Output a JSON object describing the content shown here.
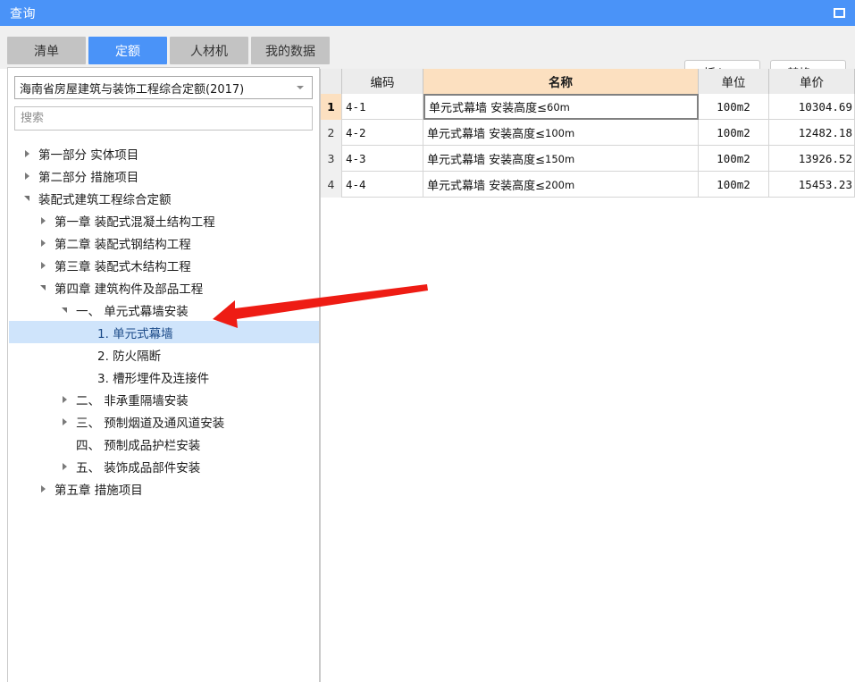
{
  "window": {
    "title": "查询",
    "restore_icon": "restore-window-icon"
  },
  "tabs": [
    {
      "label": "清单",
      "active": false
    },
    {
      "label": "定额",
      "active": true
    },
    {
      "label": "人材机",
      "active": false
    },
    {
      "label": "我的数据",
      "active": false
    }
  ],
  "toolbar": {
    "insert_label": "插入(I)",
    "replace_label": "替换(R)"
  },
  "left_panel": {
    "library_select": {
      "value": "海南省房屋建筑与装饰工程综合定额(2017)",
      "arrow_icon": "chevron-down-icon"
    },
    "search": {
      "value": "",
      "placeholder": "搜索"
    },
    "tree": [
      {
        "label": "第一部分 实体项目",
        "depth": 0,
        "state": "collapsed",
        "selected": false
      },
      {
        "label": "第二部分 措施项目",
        "depth": 0,
        "state": "collapsed",
        "selected": false
      },
      {
        "label": "装配式建筑工程综合定额",
        "depth": 0,
        "state": "expanded",
        "selected": false
      },
      {
        "label": "第一章 装配式混凝土结构工程",
        "depth": 1,
        "state": "collapsed",
        "selected": false
      },
      {
        "label": "第二章 装配式钢结构工程",
        "depth": 1,
        "state": "collapsed",
        "selected": false
      },
      {
        "label": "第三章 装配式木结构工程",
        "depth": 1,
        "state": "collapsed",
        "selected": false
      },
      {
        "label": "第四章 建筑构件及部品工程",
        "depth": 1,
        "state": "expanded",
        "selected": false
      },
      {
        "label": "一、 单元式幕墙安装",
        "depth": 2,
        "state": "expanded",
        "selected": false
      },
      {
        "label": "1. 单元式幕墙",
        "depth": 3,
        "state": "leaf",
        "selected": true
      },
      {
        "label": "2. 防火隔断",
        "depth": 3,
        "state": "leaf",
        "selected": false
      },
      {
        "label": "3. 槽形埋件及连接件",
        "depth": 3,
        "state": "leaf",
        "selected": false
      },
      {
        "label": "二、 非承重隔墙安装",
        "depth": 2,
        "state": "collapsed",
        "selected": false
      },
      {
        "label": "三、 预制烟道及通风道安装",
        "depth": 2,
        "state": "collapsed",
        "selected": false
      },
      {
        "label": "四、 预制成品护栏安装",
        "depth": 2,
        "state": "leaf",
        "selected": false
      },
      {
        "label": "五、 装饰成品部件安装",
        "depth": 2,
        "state": "collapsed",
        "selected": false
      },
      {
        "label": "第五章 措施项目",
        "depth": 1,
        "state": "collapsed",
        "selected": false
      }
    ]
  },
  "grid": {
    "columns": [
      "",
      "编码",
      "名称",
      "单位",
      "单价"
    ],
    "active_column": "名称",
    "rows": [
      {
        "no": "1",
        "code": "4-1",
        "name_main": "单元式幕墙 安装高度≤",
        "name_sub": "60m",
        "unit": "100m2",
        "price": "10304.69",
        "selected": true
      },
      {
        "no": "2",
        "code": "4-2",
        "name_main": "单元式幕墙 安装高度≤",
        "name_sub": "100m",
        "unit": "100m2",
        "price": "12482.18",
        "selected": false
      },
      {
        "no": "3",
        "code": "4-3",
        "name_main": "单元式幕墙 安装高度≤",
        "name_sub": "150m",
        "unit": "100m2",
        "price": "13926.52",
        "selected": false
      },
      {
        "no": "4",
        "code": "4-4",
        "name_main": "单元式幕墙 安装高度≤",
        "name_sub": "200m",
        "unit": "100m2",
        "price": "15453.23",
        "selected": false
      }
    ]
  },
  "annotation": {
    "arrow_color": "#ee1c14",
    "points_to": "一、 单元式幕墙安装"
  },
  "colors": {
    "title_bar": "#4a93f8",
    "tab_active": "#4a93f8",
    "tab_inactive": "#c3c3c3",
    "tree_selection": "#cfe4fb",
    "header_active_column": "#fce0c0"
  }
}
